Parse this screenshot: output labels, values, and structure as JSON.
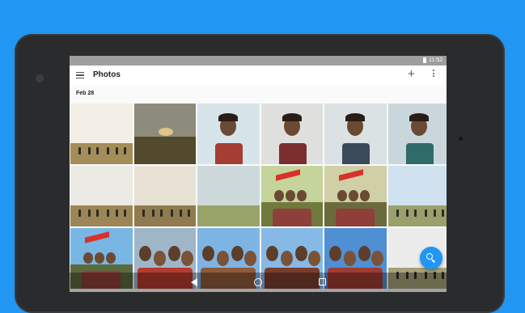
{
  "status": {
    "time": "11:52",
    "battery_icon": "battery-icon"
  },
  "app": {
    "title": "Photos",
    "menu_icon": "hamburger-menu-icon",
    "add_icon": "plus-icon",
    "overflow_icon": "more-vert-icon"
  },
  "section": {
    "date": "Feb 28"
  },
  "photos": [
    {
      "kind": "landscape-people",
      "sky": "#f3efe6",
      "ground": "#a58d59"
    },
    {
      "kind": "sunset",
      "sky": "#8d8c7c",
      "ground": "#534a2b"
    },
    {
      "kind": "portrait",
      "sky": "#d7e4ea",
      "shirt": "#a43d32"
    },
    {
      "kind": "portrait",
      "sky": "#dfe0dd",
      "shirt": "#7a2e2e"
    },
    {
      "kind": "portrait",
      "sky": "#dbe2e4",
      "shirt": "#3b4a5a"
    },
    {
      "kind": "portrait",
      "sky": "#c9d7dd",
      "shirt": "#2f6b69"
    },
    {
      "kind": "landscape-people",
      "sky": "#eceae4",
      "ground": "#9c8656"
    },
    {
      "kind": "landscape-people",
      "sky": "#e7e2d4",
      "ground": "#8f7b4d"
    },
    {
      "kind": "hills",
      "sky": "#cdd9db",
      "ground": "#98a56a"
    },
    {
      "kind": "group-flag",
      "sky": "#c5d49a",
      "ground": "#6f7a3c"
    },
    {
      "kind": "group-flag",
      "sky": "#d0cfa6",
      "ground": "#6b6a3c"
    },
    {
      "kind": "hills-people",
      "sky": "#cfe1ee",
      "ground": "#9aa06b"
    },
    {
      "kind": "group-flag",
      "sky": "#78b6e4",
      "ground": "#5c6a3d"
    },
    {
      "kind": "selfie",
      "sky": "#9fb6c9",
      "shirt": "#b53b2c"
    },
    {
      "kind": "selfie",
      "sky": "#7eb4e4",
      "shirt": "#8e5a3a"
    },
    {
      "kind": "selfie",
      "sky": "#86b9e6",
      "shirt": "#7b3d2b"
    },
    {
      "kind": "selfie",
      "sky": "#4f8fd4",
      "shirt": "#a03b33"
    },
    {
      "kind": "hills-people",
      "sky": "#ececec",
      "ground": "#a6a278"
    }
  ],
  "nav": {
    "back_icon": "back-triangle-icon",
    "home_icon": "home-circle-icon",
    "recent_icon": "recent-apps-square-icon"
  },
  "fab": {
    "icon": "search-icon",
    "color": "#2196f3"
  }
}
